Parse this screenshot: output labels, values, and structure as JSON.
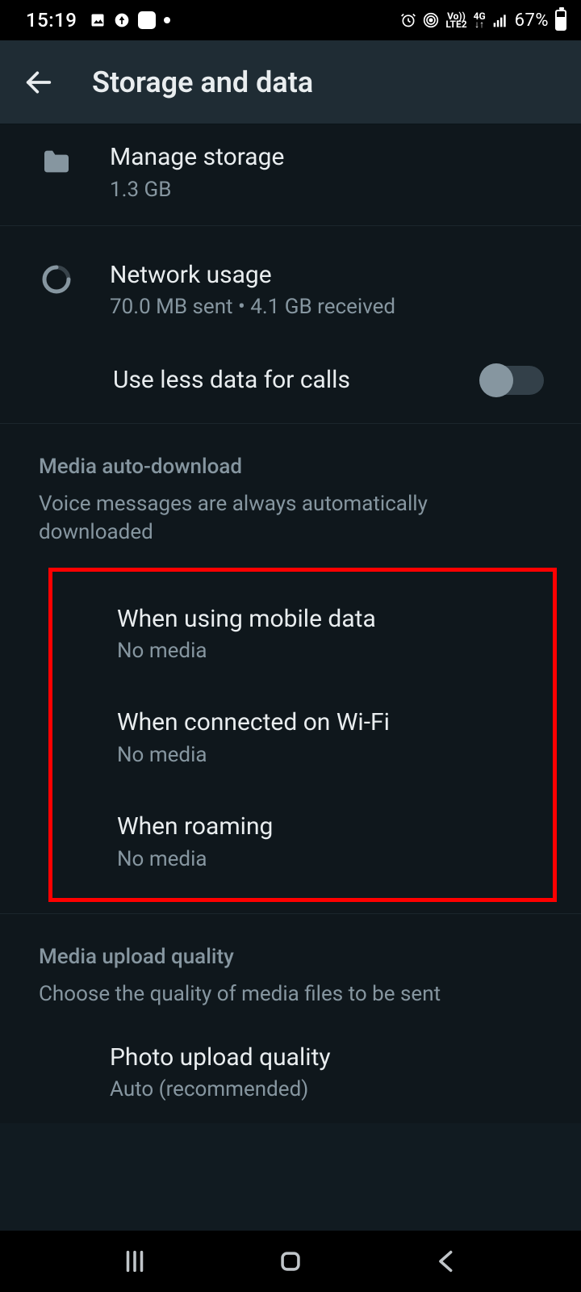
{
  "status_bar": {
    "time": "15:19",
    "battery_pct": "67%"
  },
  "header": {
    "title": "Storage and data"
  },
  "items": {
    "manage_storage": {
      "title": "Manage storage",
      "sub": "1.3 GB"
    },
    "network_usage": {
      "title": "Network usage",
      "sub": "70.0 MB sent • 4.1 GB received"
    },
    "less_data": {
      "title": "Use less data for calls"
    }
  },
  "sections": {
    "media_auto_download": {
      "header": "Media auto-download",
      "desc": "Voice messages are always automatically downloaded"
    },
    "media_upload_quality": {
      "header": "Media upload quality",
      "desc": "Choose the quality of media files to be sent"
    }
  },
  "auto_download": {
    "mobile": {
      "title": "When using mobile data",
      "sub": "No media"
    },
    "wifi": {
      "title": "When connected on Wi-Fi",
      "sub": "No media"
    },
    "roaming": {
      "title": "When roaming",
      "sub": "No media"
    }
  },
  "upload": {
    "photo": {
      "title": "Photo upload quality",
      "sub": "Auto (recommended)"
    }
  }
}
